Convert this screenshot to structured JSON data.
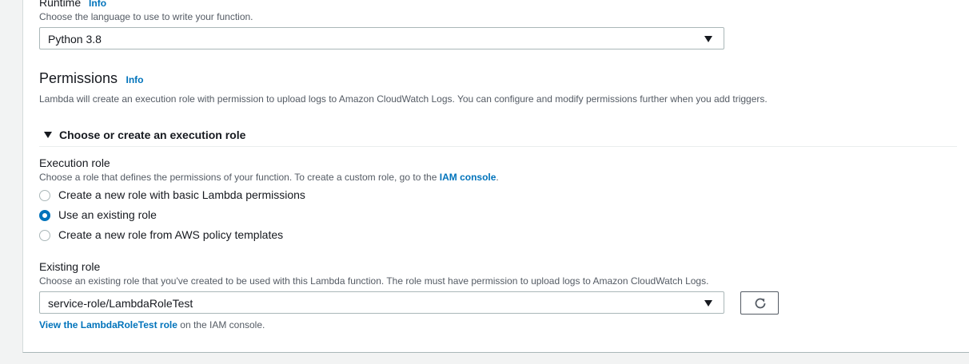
{
  "runtime": {
    "label": "Runtime",
    "info": "Info",
    "description": "Choose the language to use to write your function.",
    "selected": "Python 3.8"
  },
  "permissions": {
    "title": "Permissions",
    "info": "Info",
    "description": "Lambda will create an execution role with permission to upload logs to Amazon CloudWatch Logs. You can configure and modify permissions further when you add triggers.",
    "expander_label": "Choose or create an execution role"
  },
  "execution_role": {
    "label": "Execution role",
    "description_prefix": "Choose a role that defines the permissions of your function. To create a custom role, go to the",
    "iam_link": "IAM console",
    "description_suffix": ".",
    "options": [
      {
        "label": "Create a new role with basic Lambda permissions",
        "checked": false
      },
      {
        "label": "Use an existing role",
        "checked": true
      },
      {
        "label": "Create a new role from AWS policy templates",
        "checked": false
      }
    ]
  },
  "existing_role": {
    "label": "Existing role",
    "description": "Choose an existing role that you've created to be used with this Lambda function. The role must have permission to upload logs to Amazon CloudWatch Logs.",
    "selected": "service-role/LambdaRoleTest",
    "view_link": "View the LambdaRoleTest role",
    "view_suffix": "on the IAM console."
  },
  "icons": {
    "caret": "caret-down-icon",
    "expander": "triangle-down-icon",
    "refresh": "refresh-icon"
  }
}
